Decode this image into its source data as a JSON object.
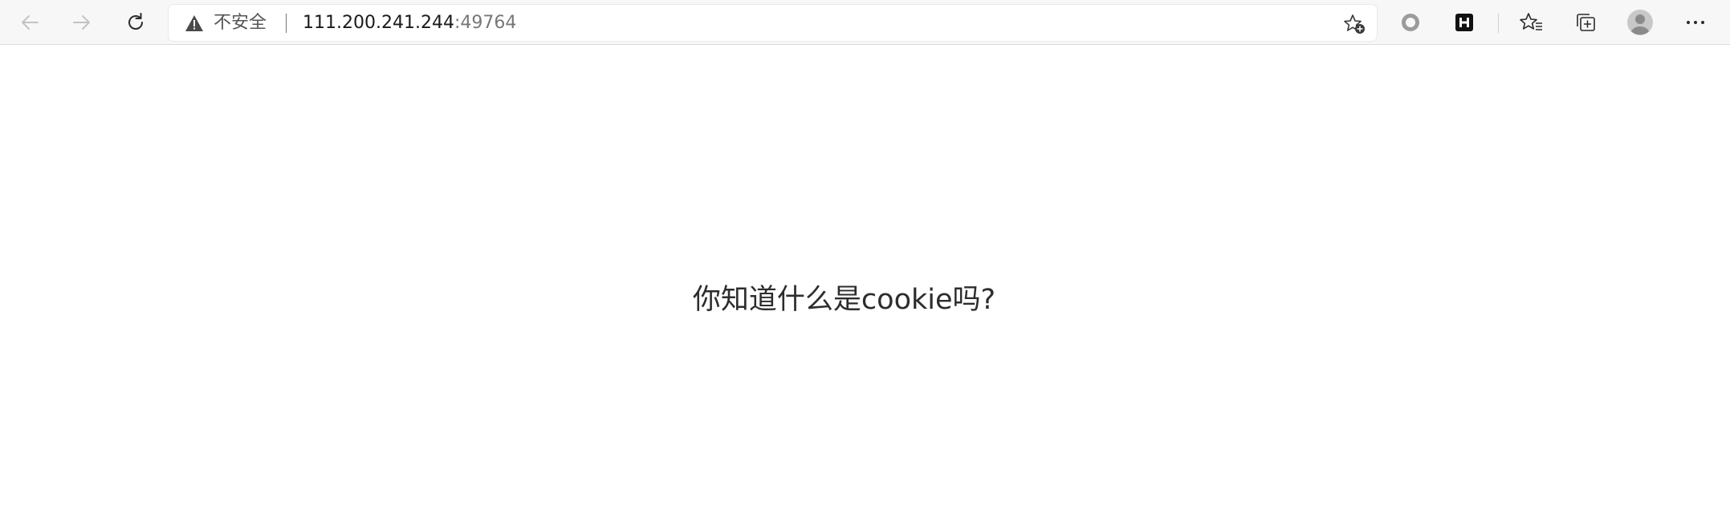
{
  "browser": {
    "security_label": "不安全",
    "url_host": "111.200.241.244",
    "url_port": ":49764"
  },
  "page": {
    "message": "你知道什么是cookie吗?"
  }
}
